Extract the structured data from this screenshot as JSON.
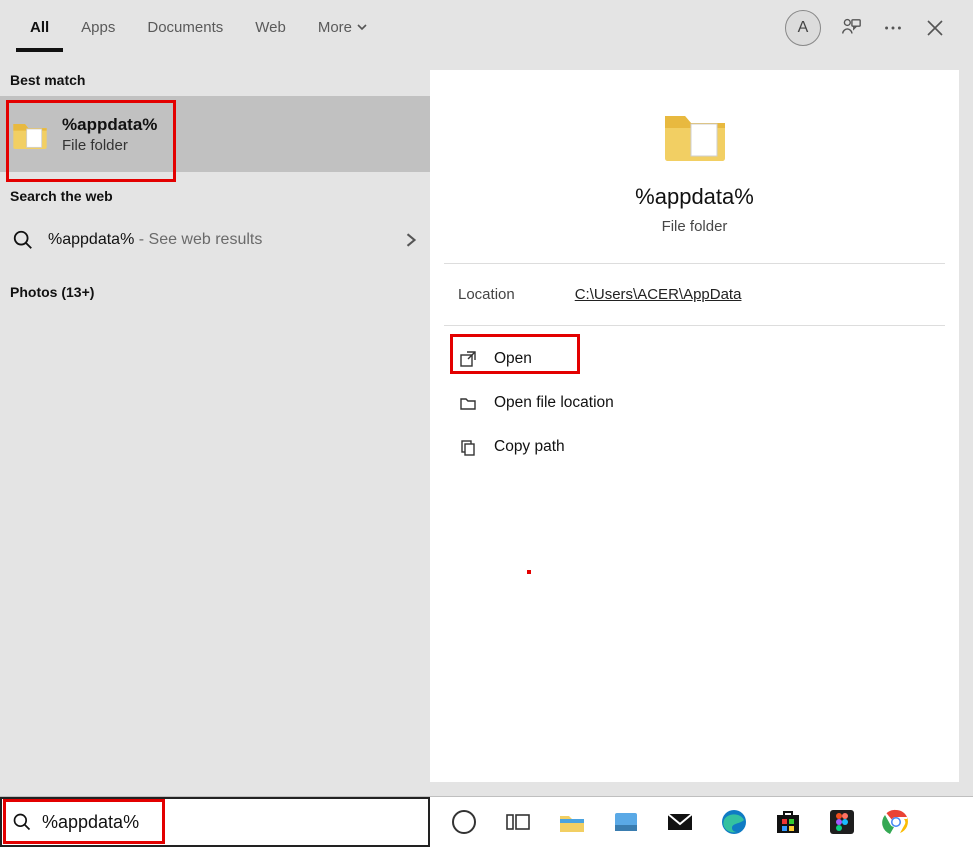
{
  "tabs": {
    "all": "All",
    "apps": "Apps",
    "documents": "Documents",
    "web": "Web",
    "more": "More"
  },
  "avatar_letter": "A",
  "sections": {
    "best_match": "Best match",
    "search_web": "Search the web",
    "photos": "Photos (13+)"
  },
  "best_match": {
    "title": "%appdata%",
    "subtitle": "File folder"
  },
  "web_result": {
    "query": "%appdata%",
    "suffix": " - See web results"
  },
  "details": {
    "title": "%appdata%",
    "subtitle": "File folder",
    "location_label": "Location",
    "location_path": "C:\\Users\\ACER\\AppData",
    "actions": {
      "open": "Open",
      "open_location": "Open file location",
      "copy_path": "Copy path"
    }
  },
  "search_input": {
    "value": "%appdata%"
  },
  "taskbar": {
    "items": [
      "cortana",
      "task-view",
      "file-explorer",
      "settings-assist",
      "mail",
      "edge",
      "store",
      "figma",
      "chrome"
    ]
  }
}
